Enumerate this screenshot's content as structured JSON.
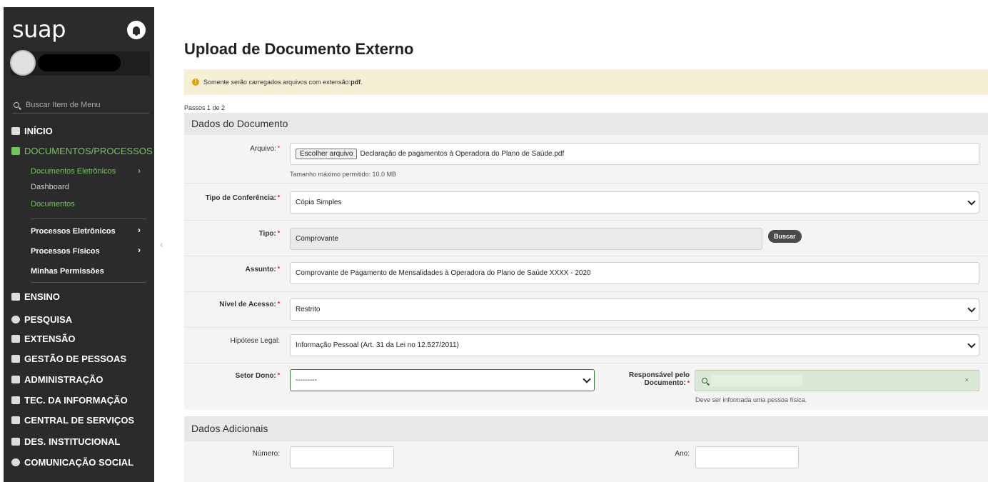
{
  "sidebar": {
    "logo": "suap",
    "search_placeholder": "Buscar Item de Menu",
    "items": [
      {
        "label": "INÍCIO"
      },
      {
        "label": "DOCUMENTOS/PROCESSOS"
      },
      {
        "label": "ENSINO"
      },
      {
        "label": "PESQUISA"
      },
      {
        "label": "EXTENSÃO"
      },
      {
        "label": "GESTÃO DE PESSOAS"
      },
      {
        "label": "ADMINISTRAÇÃO"
      },
      {
        "label": "TEC. DA INFORMAÇÃO"
      },
      {
        "label": "CENTRAL DE SERVIÇOS"
      },
      {
        "label": "DES. INSTITUCIONAL"
      },
      {
        "label": "COMUNICAÇÃO SOCIAL"
      }
    ],
    "sub_items": {
      "documentos_eletronicos": "Documentos Eletrônicos",
      "dashboard": "Dashboard",
      "documentos": "Documentos",
      "processos_eletronicos": "Processos Eletrônicos",
      "processos_fisicos": "Processos Físicos",
      "minhas_permissoes": "Minhas Permissões"
    },
    "active_color": "#70c75a"
  },
  "page": {
    "title": "Upload de Documento Externo",
    "alert_prefix": "Somente serão carregados arquivos com extensão: ",
    "alert_ext": "pdf",
    "alert_suffix": ".",
    "steps": "Passos 1 de 2"
  },
  "dados_documento": {
    "header": "Dados do Documento",
    "arquivo": {
      "label": "Arquivo:",
      "button": "Escolher arquivo",
      "filename": "Declaração de pagamentos à Operadora do Plano de Saúde.pdf",
      "hint": "Tamanho máximo permitido: 10.0 MB"
    },
    "tipo_conferencia": {
      "label": "Tipo de Conferência:",
      "value": "Cópia Simples"
    },
    "tipo": {
      "label": "Tipo:",
      "value": "Comprovante",
      "button": "Buscar"
    },
    "assunto": {
      "label": "Assunto:",
      "value": "Comprovante de Pagamento de Mensalidades à Operadora do Plano de Saúde XXXX - 2020"
    },
    "nivel_acesso": {
      "label": "Nível de Acesso:",
      "value": "Restrito"
    },
    "hipotese_legal": {
      "label": "Hipótese Legal:",
      "value": "Informação Pessoal (Art. 31 da Lei no 12.527/2011)"
    },
    "setor_dono": {
      "label": "Setor Dono:",
      "value": "---------"
    },
    "responsavel": {
      "label_line1": "Responsável pelo",
      "label_line2": "Documento:",
      "clear": "×",
      "hint": "Deve ser informada uma pessoa física."
    }
  },
  "dados_adicionais": {
    "header": "Dados Adicionais",
    "numero": {
      "label": "Número:",
      "value": ""
    },
    "ano": {
      "label": "Ano:",
      "value": ""
    }
  }
}
